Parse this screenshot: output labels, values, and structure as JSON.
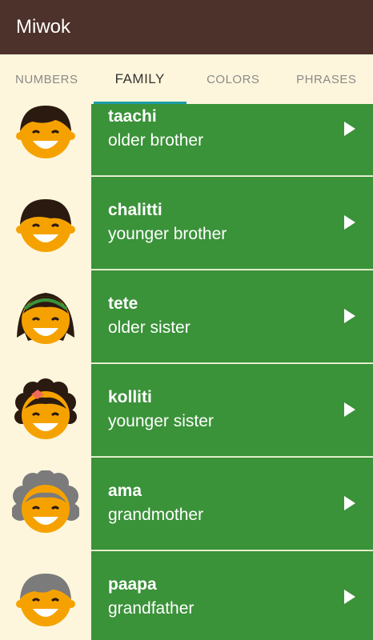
{
  "app": {
    "title": "Miwok"
  },
  "tabs": [
    {
      "label": "NUMBERS"
    },
    {
      "label": "FAMILY"
    },
    {
      "label": "COLORS"
    },
    {
      "label": "PHRASES"
    }
  ],
  "items": [
    {
      "miwok": "taachi",
      "english": "older brother",
      "icon": "older-brother-icon"
    },
    {
      "miwok": "chalitti",
      "english": "younger brother",
      "icon": "younger-brother-icon"
    },
    {
      "miwok": "tete",
      "english": "older sister",
      "icon": "older-sister-icon"
    },
    {
      "miwok": "kolliti",
      "english": "younger sister",
      "icon": "younger-sister-icon"
    },
    {
      "miwok": "ama",
      "english": "grandmother",
      "icon": "grandmother-icon"
    },
    {
      "miwok": "paapa",
      "english": "grandfather",
      "icon": "grandfather-icon"
    }
  ],
  "colors": {
    "primary": "#4D322B",
    "accent": "#1E9BA6",
    "family": "#3A9239",
    "background": "#FEF6DC"
  }
}
